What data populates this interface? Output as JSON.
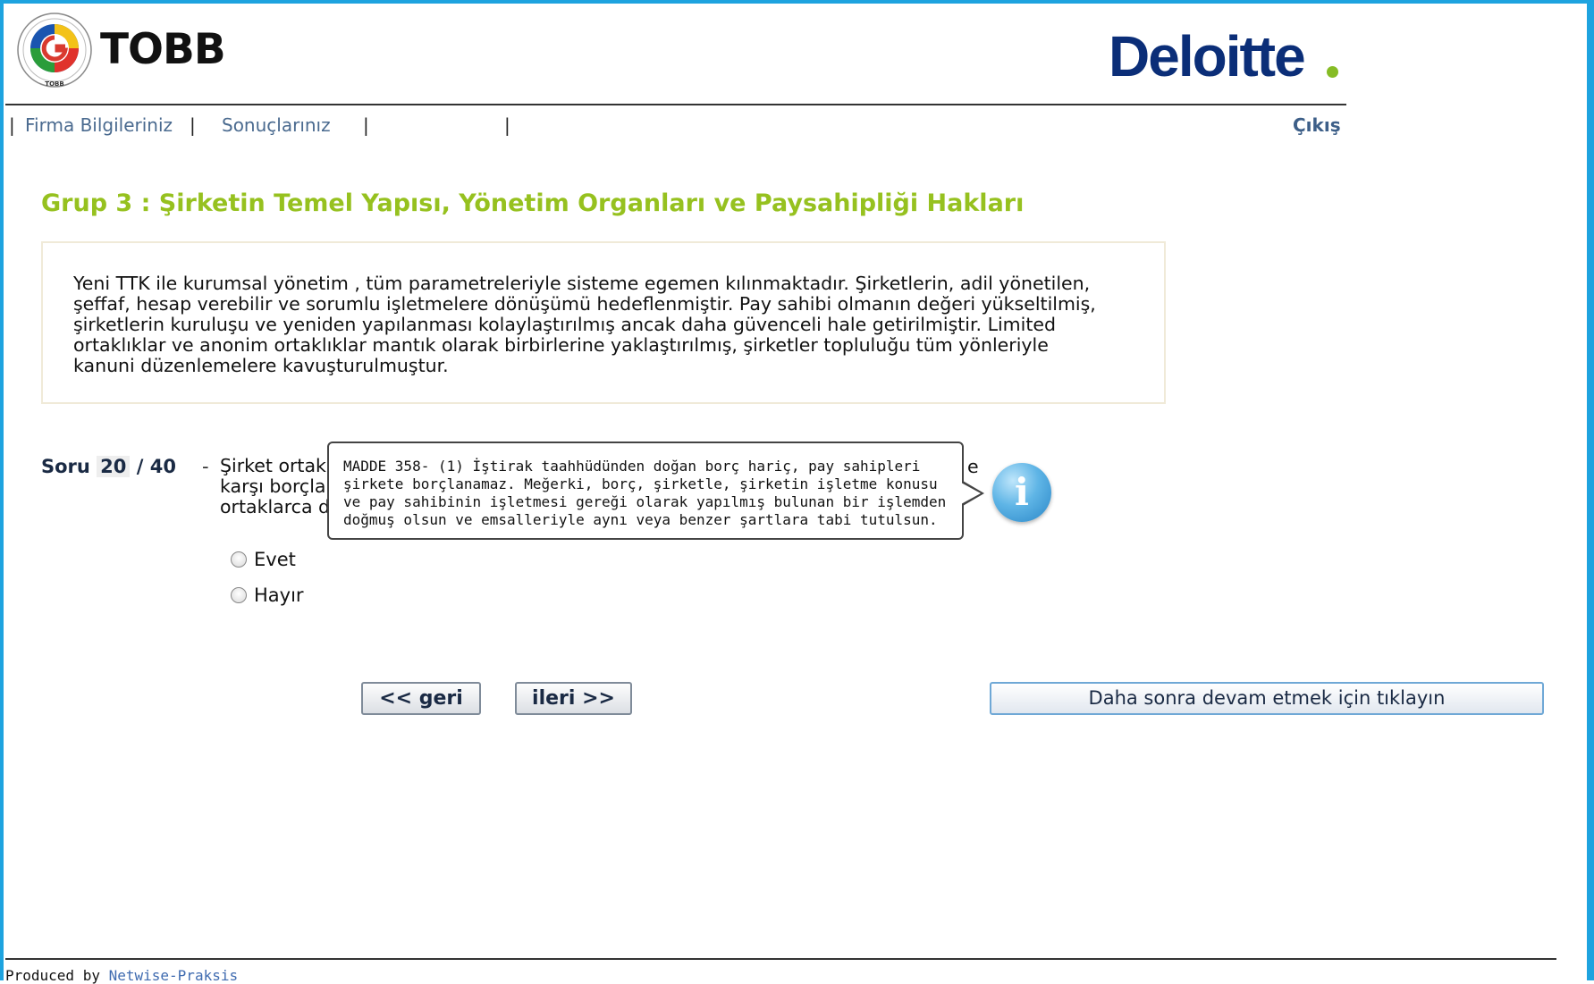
{
  "header": {
    "tobb_logo_text": "TOBB",
    "tobb_seal_text": "TOBB",
    "deloitte_logo_text": "Deloitte"
  },
  "nav": {
    "items": [
      {
        "label": "Firma Bilgileriniz"
      },
      {
        "label": "Sonuçlarınız"
      }
    ],
    "logout_label": "Çıkış"
  },
  "group": {
    "title": "Grup 3 : Şirketin Temel Yapısı, Yönetim Organları ve Paysahipliği Hakları",
    "intro_lines": [
      "Yeni TTK ile kurumsal yönetim , tüm parametreleriyle sisteme egemen kılınmaktadır. Şirketlerin, adil yönetilen,",
      "şeffaf, hesap verebilir ve sorumlu işletmelere dönüşümü hedeflenmiştir. Pay sahibi olmanın değeri yükseltilmiş,",
      "şirketlerin kuruluşu ve yeniden yapılanması kolaylaştırılmış ancak daha güvenceli hale getirilmiştir. Limited",
      "ortaklıklar ve anonim ortaklıklar mantık olarak birbirlerine yaklaştırılmış, şirketler topluluğu tüm yönleriyle",
      "kanuni düzenlemelere kavuşturulmuştur."
    ]
  },
  "question": {
    "prefix": "Soru",
    "current": "20",
    "separator": "/",
    "total": "40",
    "dash": "-",
    "text_visible_lines": [
      "Şirket ortak",
      "karşı borçla",
      "ortaklarca d"
    ],
    "text_trailing": "e",
    "options": [
      {
        "label": "Evet"
      },
      {
        "label": "Hayır"
      }
    ]
  },
  "tooltip": {
    "lines": [
      "MADDE 358- (1) İştirak taahhüdünden doğan borç hariç, pay sahipleri",
      "şirkete borçlanamaz. Meğerki, borç, şirketle, şirketin işletme konusu",
      "ve pay sahibinin işletmesi gereği olarak yapılmış bulunan bir işlemden",
      "doğmuş olsun ve emsalleriyle aynı veya benzer şartlara tabi tutulsun."
    ]
  },
  "buttons": {
    "back_label": "<< geri",
    "next_label": "ileri >>",
    "later_label": "Daha sonra devam etmek için tıklayın"
  },
  "footer": {
    "produced_by": "Produced by",
    "company": "Netwise-Praksis"
  },
  "colors": {
    "frame": "#1ea3df",
    "group_title": "#96c11f",
    "deloitte_blue": "#0b2e78",
    "deloitte_green": "#86bc25",
    "nav_link": "#4a6a8f"
  }
}
